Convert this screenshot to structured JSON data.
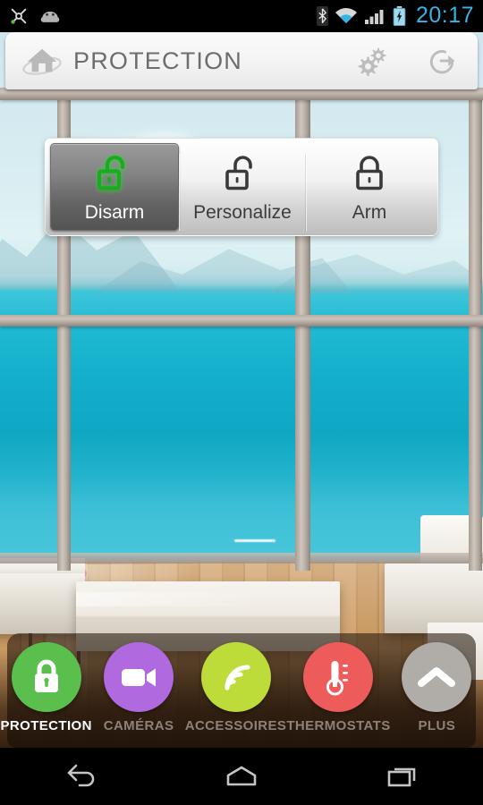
{
  "statusbar": {
    "time": "20:17",
    "icons": [
      {
        "name": "cyanogenmod-icon"
      },
      {
        "name": "android-robot-icon"
      },
      {
        "name": "bluetooth-icon"
      },
      {
        "name": "wifi-icon"
      },
      {
        "name": "cellular-signal-icon"
      },
      {
        "name": "battery-charging-icon"
      }
    ],
    "accent_color": "#33b5e5"
  },
  "header": {
    "title": "PROTECTION",
    "logo_icon": "home-orbit-logo-icon",
    "settings_icon": "gears-icon",
    "logout_icon": "logout-icon",
    "title_color": "#6d6d6d"
  },
  "segmented_control": {
    "selected_index": 0,
    "buttons": [
      {
        "label": "Disarm",
        "icon": "unlocked-padlock-icon",
        "icon_color": "#15a01a",
        "selected": true
      },
      {
        "label": "Personalize",
        "icon": "unlocked-padlock-icon",
        "icon_color": "#3a3a3a",
        "selected": false
      },
      {
        "label": "Arm",
        "icon": "locked-padlock-icon",
        "icon_color": "#3a3a3a",
        "selected": false
      }
    ]
  },
  "tabbar": {
    "active_index": 0,
    "tabs": [
      {
        "label": "PROTECTION",
        "icon": "padlock-icon",
        "color": "#5abf4c",
        "active": true
      },
      {
        "label": "CAMÉRAS",
        "icon": "video-camera-icon",
        "color": "#b169e0",
        "active": false
      },
      {
        "label": "ACCESSOIRES",
        "icon": "wifi-signal-icon",
        "color": "#bddc3a",
        "active": false
      },
      {
        "label": "THERMOSTATS",
        "icon": "thermometer-icon",
        "color": "#ee5b5b",
        "active": false
      },
      {
        "label": "PLUS",
        "icon": "chevron-up-icon",
        "color": "#b0ada9",
        "active": false
      }
    ]
  },
  "navbar": {
    "buttons": [
      {
        "name": "back-button",
        "icon": "back-arrow-icon"
      },
      {
        "name": "home-button",
        "icon": "home-pentagon-icon"
      },
      {
        "name": "recents-button",
        "icon": "recent-apps-icon"
      }
    ]
  }
}
